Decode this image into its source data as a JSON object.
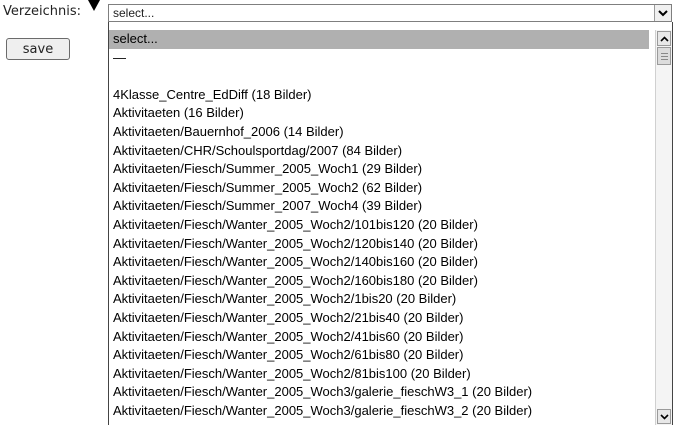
{
  "form": {
    "label": "Verzeichnis:",
    "select_value": "select...",
    "save_label": "save"
  },
  "dropdown": {
    "items": [
      "select...",
      "—",
      "",
      "4Klasse_Centre_EdDiff (18 Bilder)",
      "Aktivitaeten (16 Bilder)",
      "Aktivitaeten/Bauernhof_2006 (14 Bilder)",
      "Aktivitaeten/CHR/Schoulsportdag/2007 (84 Bilder)",
      "Aktivitaeten/Fiesch/Summer_2005_Woch1 (29 Bilder)",
      "Aktivitaeten/Fiesch/Summer_2005_Woch2 (62 Bilder)",
      "Aktivitaeten/Fiesch/Summer_2007_Woch4 (39 Bilder)",
      "Aktivitaeten/Fiesch/Wanter_2005_Woch2/101bis120 (20 Bilder)",
      "Aktivitaeten/Fiesch/Wanter_2005_Woch2/120bis140 (20 Bilder)",
      "Aktivitaeten/Fiesch/Wanter_2005_Woch2/140bis160 (20 Bilder)",
      "Aktivitaeten/Fiesch/Wanter_2005_Woch2/160bis180 (20 Bilder)",
      "Aktivitaeten/Fiesch/Wanter_2005_Woch2/1bis20 (20 Bilder)",
      "Aktivitaeten/Fiesch/Wanter_2005_Woch2/21bis40 (20 Bilder)",
      "Aktivitaeten/Fiesch/Wanter_2005_Woch2/41bis60 (20 Bilder)",
      "Aktivitaeten/Fiesch/Wanter_2005_Woch2/61bis80 (20 Bilder)",
      "Aktivitaeten/Fiesch/Wanter_2005_Woch2/81bis100 (20 Bilder)",
      "Aktivitaeten/Fiesch/Wanter_2005_Woch3/galerie_fieschW3_1 (20 Bilder)",
      "Aktivitaeten/Fiesch/Wanter_2005_Woch3/galerie_fieschW3_2 (20 Bilder)"
    ],
    "selected_index": 0
  },
  "icons": {
    "select_arrow": "chevron-down-icon",
    "scroll_up": "scroll-up-icon",
    "scroll_down": "scroll-down-icon"
  },
  "colors": {
    "selected_bg": "#b0b0b0"
  }
}
